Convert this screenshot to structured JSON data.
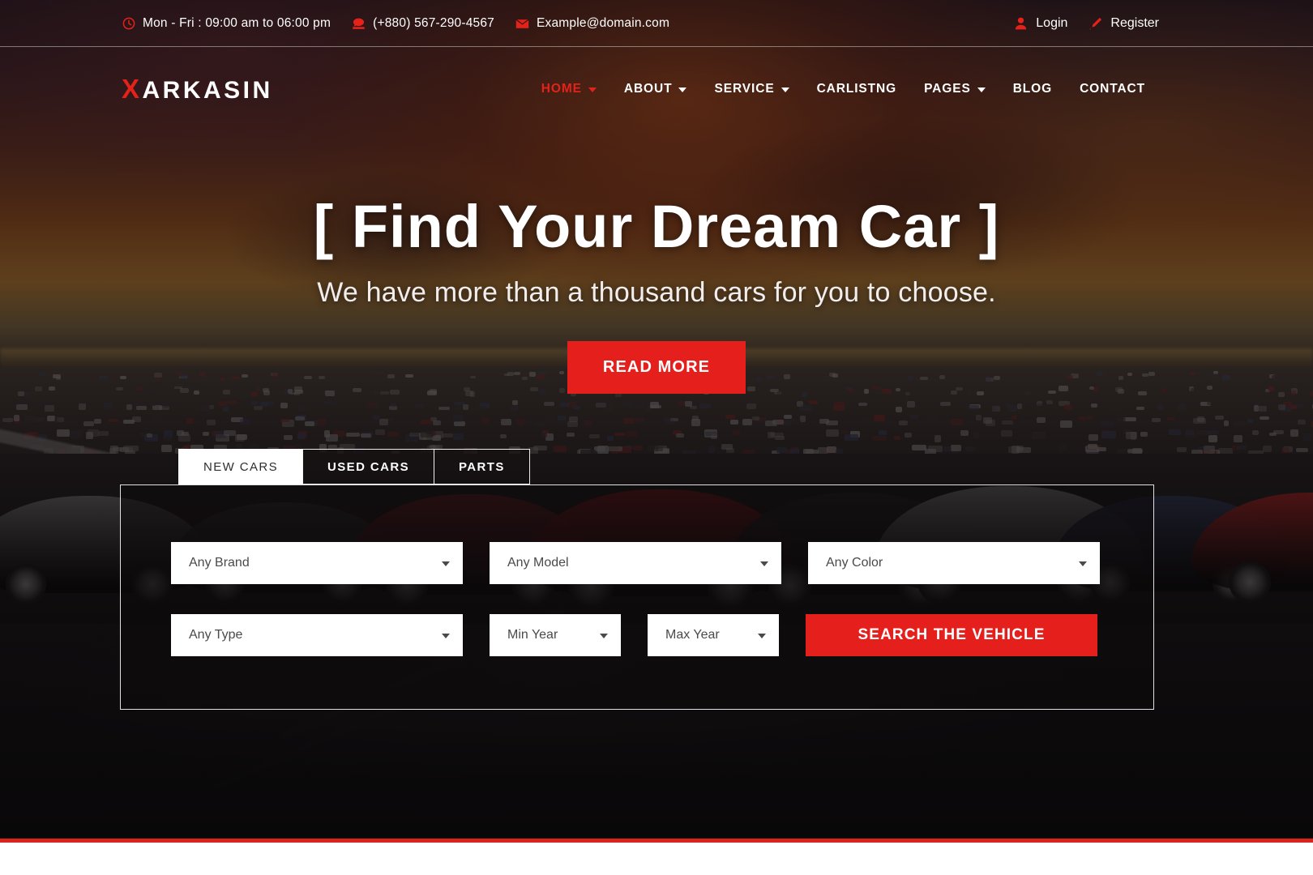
{
  "topbar": {
    "hours": "Mon - Fri : 09:00 am to 06:00 pm",
    "phone": "(+880) 567-290-4567",
    "email": "Example@domain.com",
    "login_label": "Login",
    "register_label": "Register",
    "accent_color": "#e32219"
  },
  "header": {
    "logo_mark": "X",
    "logo_text": "ARKASIN",
    "nav": [
      {
        "label": "HOME",
        "has_caret": true,
        "active": true
      },
      {
        "label": "ABOUT",
        "has_caret": true,
        "active": false
      },
      {
        "label": "SERVICE",
        "has_caret": true,
        "active": false
      },
      {
        "label": "CARLISTNG",
        "has_caret": false,
        "active": false
      },
      {
        "label": "PAGES",
        "has_caret": true,
        "active": false
      },
      {
        "label": "BLOG",
        "has_caret": false,
        "active": false
      },
      {
        "label": "CONTACT",
        "has_caret": false,
        "active": false
      }
    ]
  },
  "hero": {
    "title": "[ Find Your Dream Car ]",
    "subtitle": "We have more than a thousand cars for you to choose.",
    "cta_label": "READ MORE",
    "cta_color": "#e5201c"
  },
  "search": {
    "tabs": [
      {
        "label": "NEW CARS",
        "active": true
      },
      {
        "label": "USED CARS",
        "active": false
      },
      {
        "label": "PARTS",
        "active": false
      }
    ],
    "fields": {
      "brand": "Any Brand",
      "model": "Any Model",
      "color": "Any Color",
      "type": "Any Type",
      "min_year": "Min Year",
      "max_year": "Max Year"
    },
    "submit_label": "SEARCH THE VEHICLE"
  },
  "footer": {
    "rule_color": "#d9231f"
  }
}
